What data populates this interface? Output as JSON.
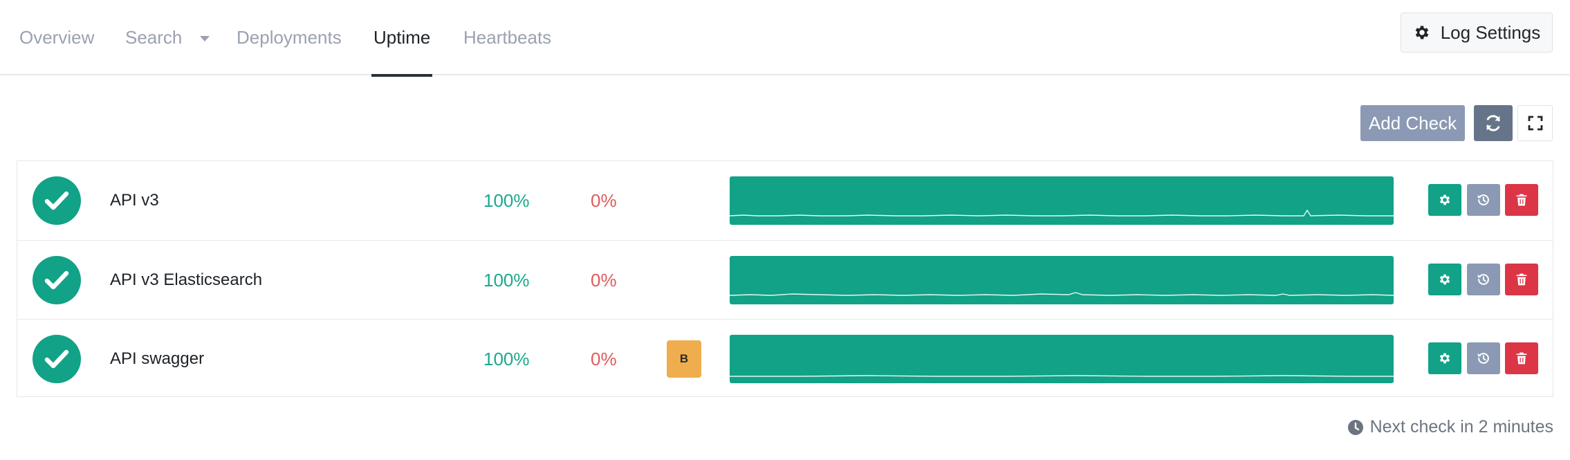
{
  "nav": {
    "tabs": [
      {
        "label": "Overview",
        "active": false
      },
      {
        "label": "Search",
        "active": false,
        "has_dropdown": true
      },
      {
        "label": "Deployments",
        "active": false
      },
      {
        "label": "Uptime",
        "active": true
      },
      {
        "label": "Heartbeats",
        "active": false
      }
    ],
    "log_settings_label": "Log Settings"
  },
  "toolbar": {
    "add_check_label": "Add Check",
    "refresh_icon": "refresh-icon",
    "fullscreen_icon": "fullscreen-icon"
  },
  "checks": [
    {
      "name": "API v3",
      "status": "up",
      "uptime": "100%",
      "downtime": "0%",
      "badge": "",
      "icons": [
        "gear-icon",
        "history-icon",
        "trash-icon"
      ]
    },
    {
      "name": "API v3 Elasticsearch",
      "status": "up",
      "uptime": "100%",
      "downtime": "0%",
      "badge": "",
      "icons": [
        "gear-icon",
        "history-icon",
        "trash-icon"
      ]
    },
    {
      "name": "API swagger",
      "status": "up",
      "uptime": "100%",
      "downtime": "0%",
      "badge": "B",
      "icons": [
        "gear-icon",
        "history-icon",
        "trash-icon"
      ]
    }
  ],
  "footer": {
    "next_check": "Next check in 2 minutes"
  },
  "colors": {
    "up": "#11a287",
    "down_text": "#e05a5a",
    "badge": "#f0ad4e",
    "delete": "#dc3545",
    "secondary": "#8b99b4"
  }
}
